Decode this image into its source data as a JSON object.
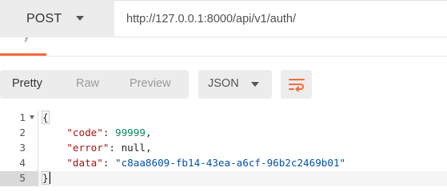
{
  "request": {
    "method": "POST",
    "url": "http://127.0.0.1:8000/api/v1/auth/"
  },
  "tab_strip": {
    "cutoff_text": "y"
  },
  "toolbar": {
    "view_tabs": [
      "Pretty",
      "Raw",
      "Preview"
    ],
    "active_view": "Pretty",
    "format": "JSON",
    "wrap_icon": "wrap-lines-icon"
  },
  "code": {
    "line_numbers": [
      "1",
      "2",
      "3",
      "4",
      "5"
    ],
    "lines": [
      "{",
      "    \"code\": 99999,",
      "    \"error\": null,",
      "    \"data\": \"c8aa8609-fb14-43ea-a6cf-96b2c2469b01\"",
      "}"
    ],
    "code_key": "\"code\"",
    "code_value": "99999",
    "error_key": "\"error\"",
    "error_value": "null",
    "data_key": "\"data\"",
    "data_value": "\"c8aa8609-fb14-43ea-a6cf-96b2c2469b01\"",
    "active_line": "5"
  },
  "colors": {
    "accent": "#f26b3a",
    "key": "#a31515",
    "number": "#0e8a5f",
    "string": "#0451a5"
  }
}
